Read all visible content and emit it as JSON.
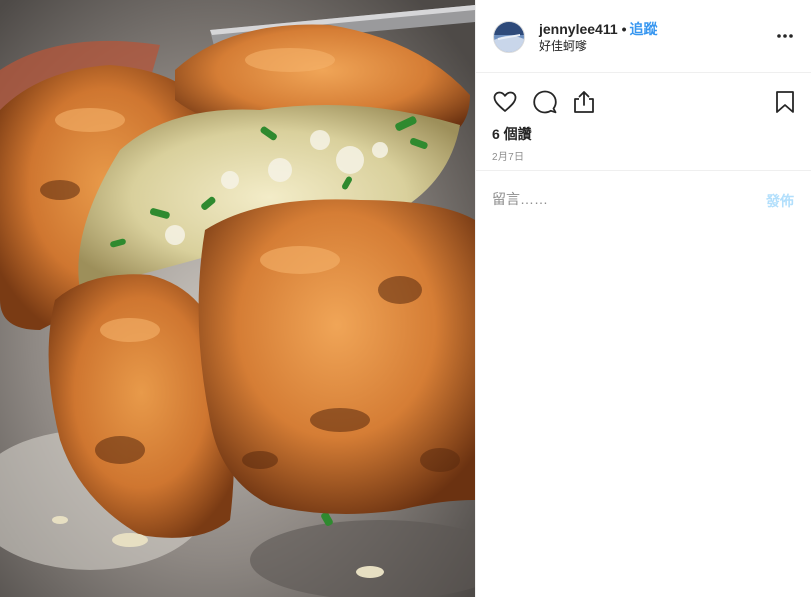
{
  "post": {
    "photo_alt": "",
    "username": "jennylee411",
    "separator": "•",
    "follow_label": "追蹤",
    "location": "好佳蚵嗲",
    "likes": "6 個讚",
    "date": "2月7日"
  },
  "comment": {
    "placeholder": "留言……",
    "value": "",
    "post_label": "發佈"
  },
  "icons": {
    "more": "more-options-icon",
    "like": "heart-icon",
    "comment": "comment-bubble-icon",
    "share": "share-icon",
    "save": "bookmark-icon"
  },
  "colors": {
    "accent": "#3897f0",
    "post_disabled": "#b2dffc",
    "text": "#262626",
    "muted": "#8e8e8e",
    "divider": "#efefef"
  }
}
